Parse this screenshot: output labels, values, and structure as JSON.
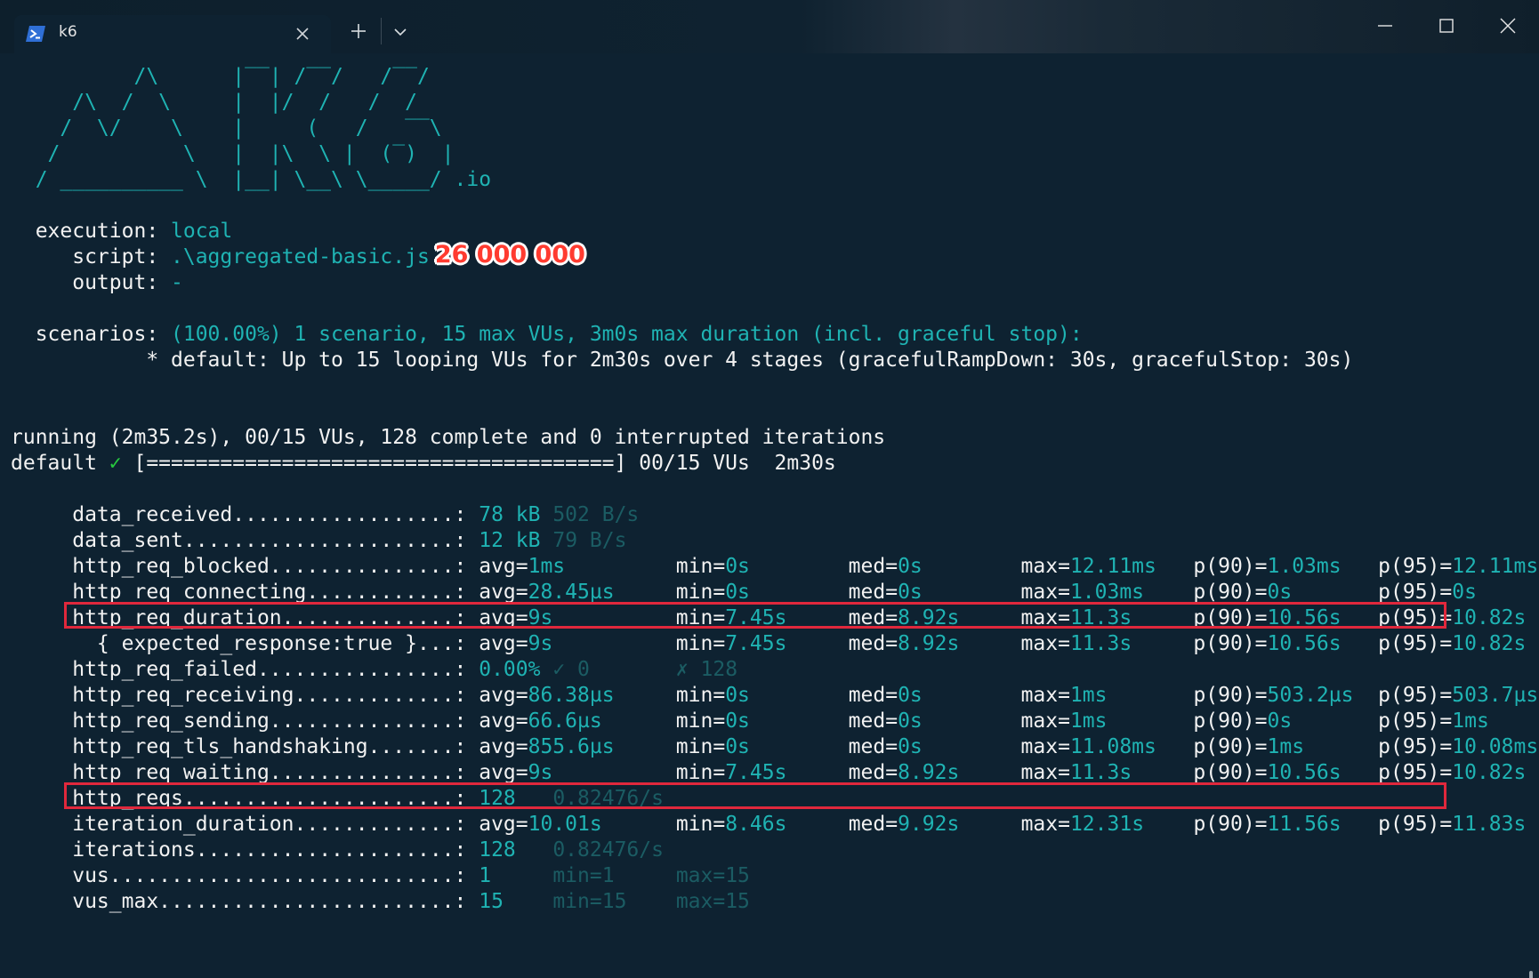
{
  "tab": {
    "title": "k6"
  },
  "logo": {
    "lines": [
      "          /\\      |‾‾| /‾‾/   /‾‾/",
      "     /\\  /  \\     |  |/  /   /  /",
      "    /  \\/    \\    |     (   /   ‾‾\\",
      "   /          \\   |  |\\  \\ |  (‾)  |",
      "  / __________ \\  |__| \\__\\ \\_____/"
    ],
    "suffix": " .io"
  },
  "execution": {
    "execution_label": "  execution: ",
    "execution_value": "local",
    "script_label": "     script: ",
    "script_value": ".\\aggregated-basic.js",
    "annotation": "26 000 000",
    "output_label": "     output: ",
    "output_value": "-"
  },
  "scenarios": {
    "label": "  scenarios: ",
    "summary": "(100.00%) 1 scenario, 15 max VUs, 3m0s max duration (incl. graceful stop):",
    "detail": "           * default: Up to 15 looping VUs for 2m30s over 4 stages (gracefulRampDown: 30s, gracefulStop: 30s)"
  },
  "progress": {
    "running": "running (2m35.2s), 00/15 VUs, 128 complete and 0 interrupted iterations",
    "default_label": "default ",
    "check": "✓",
    "bar": " [======================================] 00/15 VUs  2m30s"
  },
  "metrics": [
    {
      "name": "data_received",
      "dots": "..................:",
      "type": "rate",
      "value": "78 kB",
      "rate": "502 B/s"
    },
    {
      "name": "data_sent",
      "dots": "......................:",
      "type": "rate",
      "value": "12 kB",
      "rate": "79 B/s"
    },
    {
      "name": "http_req_blocked",
      "dots": "...............:",
      "type": "trend",
      "avg": "1ms",
      "min": "0s",
      "med": "0s",
      "max": "12.11ms",
      "p90": "1.03ms",
      "p95": "12.11ms"
    },
    {
      "name": "http_req_connecting",
      "dots": "............:",
      "type": "trend",
      "avg": "28.45µs",
      "min": "0s",
      "med": "0s",
      "max": "1.03ms",
      "p90": "0s",
      "p95": "0s"
    },
    {
      "name": "http_req_duration",
      "dots": "..............:",
      "type": "trend",
      "avg": "9s",
      "min": "7.45s",
      "med": "8.92s",
      "max": "11.3s",
      "p90": "10.56s",
      "p95": "10.82s",
      "highlighted": true
    },
    {
      "name": "  { expected_response:true }",
      "dots": "...:",
      "type": "trend",
      "avg": "9s",
      "min": "7.45s",
      "med": "8.92s",
      "max": "11.3s",
      "p90": "10.56s",
      "p95": "10.82s"
    },
    {
      "name": "http_req_failed",
      "dots": "................:",
      "type": "failed",
      "value": "0.00%",
      "pass": "✓ 0",
      "fail": "✗ 128"
    },
    {
      "name": "http_req_receiving",
      "dots": ".............:",
      "type": "trend",
      "avg": "86.38µs",
      "min": "0s",
      "med": "0s",
      "max": "1ms",
      "p90": "503.2µs",
      "p95": "503.7µs"
    },
    {
      "name": "http_req_sending",
      "dots": "...............:",
      "type": "trend",
      "avg": "66.6µs",
      "min": "0s",
      "med": "0s",
      "max": "1ms",
      "p90": "0s",
      "p95": "1ms"
    },
    {
      "name": "http_req_tls_handshaking",
      "dots": ".......:",
      "type": "trend",
      "avg": "855.6µs",
      "min": "0s",
      "med": "0s",
      "max": "11.08ms",
      "p90": "1ms",
      "p95": "10.08ms"
    },
    {
      "name": "http_req_waiting",
      "dots": "...............:",
      "type": "trend",
      "avg": "9s",
      "min": "7.45s",
      "med": "8.92s",
      "max": "11.3s",
      "p90": "10.56s",
      "p95": "10.82s"
    },
    {
      "name": "http_reqs",
      "dots": "......................:",
      "type": "rate",
      "value": "128",
      "rate": "0.82476/s",
      "highlighted": true
    },
    {
      "name": "iteration_duration",
      "dots": ".............:",
      "type": "trend",
      "avg": "10.01s",
      "min": "8.46s",
      "med": "9.92s",
      "max": "12.31s",
      "p90": "11.56s",
      "p95": "11.83s"
    },
    {
      "name": "iterations",
      "dots": ".....................:",
      "type": "rate",
      "value": "128",
      "rate": "0.82476/s"
    },
    {
      "name": "vus",
      "dots": "............................:",
      "type": "gauge",
      "value": "1",
      "min": "min=1",
      "max": "max=15"
    },
    {
      "name": "vus_max",
      "dots": "........................:",
      "type": "gauge",
      "value": "15",
      "min": "min=15",
      "max": "max=15"
    }
  ],
  "colors": {
    "background": "#0e2231",
    "cyan": "#1fb3b3",
    "dim": "#1b5c63",
    "text": "#f2f2f2",
    "highlight": "#e0283c",
    "annotation": "#ff3b30"
  }
}
